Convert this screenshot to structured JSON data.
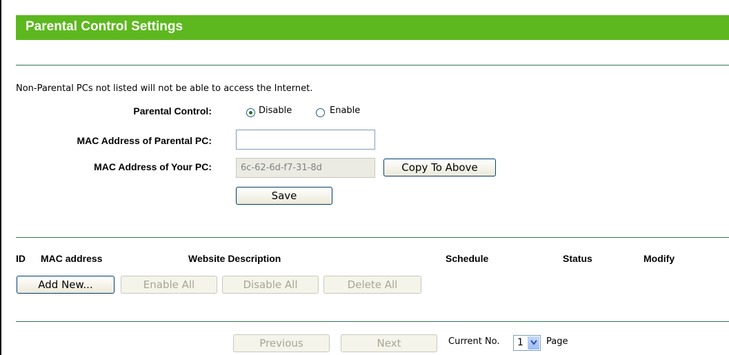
{
  "title": "Parental Control Settings",
  "notice": "Non-Parental PCs not listed will not be able to access the Internet.",
  "form": {
    "parental_control_label": "Parental Control:",
    "disable_label": "Disable",
    "enable_label": "Enable",
    "selected": "Disable",
    "parental_mac_label": "MAC Address of Parental PC:",
    "parental_mac_value": "",
    "your_mac_label": "MAC Address of Your PC:",
    "your_mac_value": "6c-62-6d-f7-31-8d",
    "copy_button": "Copy To Above",
    "save_button": "Save"
  },
  "table": {
    "columns": [
      "ID",
      "MAC address",
      "Website Description",
      "Schedule",
      "Status",
      "Modify"
    ],
    "rows": []
  },
  "actions": {
    "add_new": "Add New...",
    "enable_all": "Enable All",
    "disable_all": "Disable All",
    "delete_all": "Delete All"
  },
  "pager": {
    "previous": "Previous",
    "next": "Next",
    "current_no_label": "Current No.",
    "current_page": "1",
    "page_label": "Page"
  },
  "colors": {
    "title_bar": "#5db81f",
    "divider": "#2f7a52"
  }
}
